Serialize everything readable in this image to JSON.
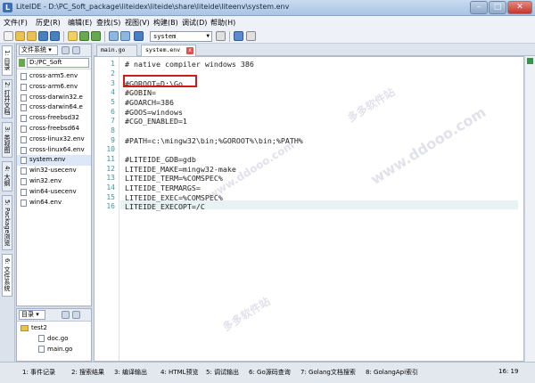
{
  "window": {
    "app_icon": "L",
    "title": "LiteIDE - D:\\PC_Soft_package\\liteidex\\liteide\\share\\liteide\\liteenv\\system.env",
    "minimize": "–",
    "maximize": "□",
    "close": "✕"
  },
  "menu": [
    "文件(F)",
    "历史(R)",
    "编辑(E)",
    "查找(S)",
    "视图(V)",
    "构建(B)",
    "调试(D)",
    "帮助(H)"
  ],
  "toolbar": {
    "env_combo": "system"
  },
  "side_tabs": [
    "1: 目录",
    "2: 打开文档",
    "3: 类视图",
    "4: 大纲",
    "5: Package浏览",
    "6: 文件系统"
  ],
  "fs_panel": {
    "header": "文件系统",
    "path": "D:/PC_Soft",
    "files": [
      "cross-arm5.env",
      "cross-arm6.env",
      "cross-darwin32.e",
      "cross-darwin64.e",
      "cross-freebsd32",
      "cross-freebsd64",
      "cross-linux32.env",
      "cross-linux64.env",
      "system.env",
      "win32-usecenv",
      "win32.env",
      "win64-usecenv",
      "win64.env"
    ],
    "selected": "system.env"
  },
  "dir_panel": {
    "header": "目录",
    "folder": "test2",
    "files": [
      "doc.go",
      "main.go"
    ]
  },
  "editor_tabs": [
    "main.go",
    "system.env"
  ],
  "editor": {
    "lines": [
      "# native compiler windows 386",
      "",
      "#GOROOT=D:\\Go",
      "#GOBIN=",
      "#GOARCH=386",
      "#GOOS=windows",
      "#CGO_ENABLED=1",
      "",
      "#PATH=c:\\mingw32\\bin;%GOROOT%\\bin;%PATH%",
      "",
      "#LITEIDE_GDB=gdb",
      "LITEIDE_MAKE=mingw32-make",
      "LITEIDE_TERM=%COMSPEC%",
      "LITEIDE_TERMARGS=",
      "LITEIDE_EXEC=%COMSPEC%",
      "LITEIDE_EXECOPT=/C"
    ],
    "line_numbers": [
      "1",
      "2",
      "3",
      "4",
      "5",
      "6",
      "7",
      "8",
      "9",
      "10",
      "11",
      "12",
      "13",
      "14",
      "15",
      "16"
    ]
  },
  "watermark": [
    "www.ddooo.com",
    "多多软件站"
  ],
  "status": {
    "items": [
      "1: 事件记录",
      "2: 搜索结果",
      "3: 编译输出",
      "4: HTML预览",
      "5: 调试输出",
      "6: Go源码查询",
      "7: Golang文档搜索",
      "8: GolangApi索引"
    ],
    "position": "16: 19"
  },
  "colors": {
    "line_number": "#3d9a9a",
    "highlight_box": "#d11a1a",
    "current_line": "#e8f2f2"
  }
}
